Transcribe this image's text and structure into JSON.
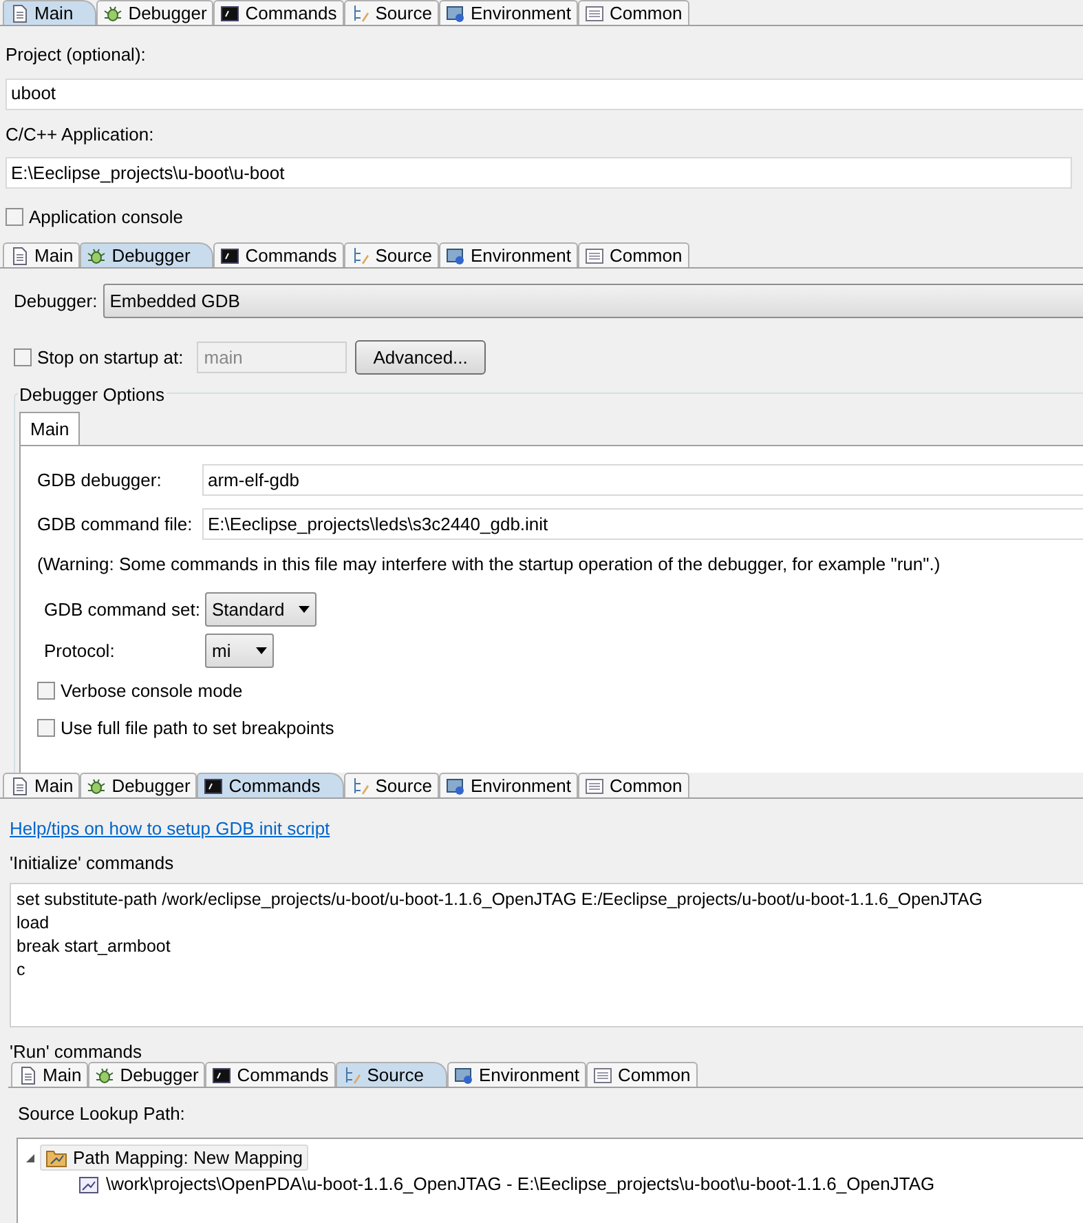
{
  "panels": [
    {
      "kind": "main",
      "tabs": [
        {
          "label": "Main",
          "kind": "page",
          "selected": true
        },
        {
          "label": "Debugger",
          "kind": "bug",
          "selected": false
        },
        {
          "label": "Commands",
          "kind": "terminal",
          "selected": false
        },
        {
          "label": "Source",
          "kind": "tree",
          "selected": false
        },
        {
          "label": "Environment",
          "kind": "env",
          "selected": false
        },
        {
          "label": "Common",
          "kind": "list",
          "selected": false
        }
      ],
      "project_label": "Project (optional):",
      "project_value": "uboot",
      "app_label": "C/C++ Application:",
      "app_value": "E:\\Eeclipse_projects\\u-boot\\u-boot",
      "console": {
        "label": "Application console",
        "checked": false
      }
    },
    {
      "kind": "debugger",
      "tabs": [
        {
          "label": "Main",
          "kind": "page",
          "selected": false
        },
        {
          "label": "Debugger",
          "kind": "bug",
          "selected": true
        },
        {
          "label": "Commands",
          "kind": "terminal",
          "selected": false
        },
        {
          "label": "Source",
          "kind": "tree",
          "selected": false
        },
        {
          "label": "Environment",
          "kind": "env",
          "selected": false
        },
        {
          "label": "Common",
          "kind": "list",
          "selected": false
        }
      ],
      "debugger_label": "Debugger:",
      "debugger_value": "Embedded GDB",
      "stop": {
        "label": "Stop on startup at:",
        "checked": false,
        "placeholder": "main"
      },
      "advanced_button": "Advanced...",
      "options_title": "Debugger Options",
      "options_tab": "Main",
      "gdb_label": "GDB debugger:",
      "gdb_value": "arm-elf-gdb",
      "cmdfile_label": "GDB command file:",
      "cmdfile_value": "E:\\Eeclipse_projects\\leds\\s3c2440_gdb.init",
      "warning": "(Warning: Some commands in this file may interfere with the startup operation of the debugger, for example \"run\".)",
      "cmdset_label": "GDB command set:",
      "cmdset_value": "Standard",
      "protocol_label": "Protocol:",
      "protocol_value": "mi",
      "options": [
        {
          "label": "Verbose console mode",
          "checked": false
        },
        {
          "label": "Use full file path to set breakpoints",
          "checked": false
        }
      ]
    },
    {
      "kind": "commands",
      "tabs": [
        {
          "label": "Main",
          "kind": "page",
          "selected": false
        },
        {
          "label": "Debugger",
          "kind": "bug",
          "selected": false
        },
        {
          "label": "Commands",
          "kind": "terminal",
          "selected": true
        },
        {
          "label": "Source",
          "kind": "tree",
          "selected": false
        },
        {
          "label": "Environment",
          "kind": "env",
          "selected": false
        },
        {
          "label": "Common",
          "kind": "list",
          "selected": false
        }
      ],
      "help_link": "Help/tips on how to setup GDB init script",
      "init_label": "'Initialize' commands",
      "init_lines": [
        "set substitute-path /work/eclipse_projects/u-boot/u-boot-1.1.6_OpenJTAG E:/Eeclipse_projects/u-boot/u-boot-1.1.6_OpenJTAG",
        "load",
        "break start_armboot",
        "c"
      ],
      "run_label": "'Run' commands"
    },
    {
      "kind": "source",
      "tabs": [
        {
          "label": "Main",
          "kind": "page",
          "selected": false
        },
        {
          "label": "Debugger",
          "kind": "bug",
          "selected": false
        },
        {
          "label": "Commands",
          "kind": "terminal",
          "selected": false
        },
        {
          "label": "Source",
          "kind": "tree",
          "selected": true
        },
        {
          "label": "Environment",
          "kind": "env",
          "selected": false
        },
        {
          "label": "Common",
          "kind": "list",
          "selected": false
        }
      ],
      "lookup_label": "Source Lookup Path:",
      "tree": [
        {
          "label": "Path Mapping: New Mapping",
          "expanded": true,
          "children": [
            {
              "label": "\\work\\projects\\OpenPDA\\u-boot-1.1.6_OpenJTAG - E:\\Eeclipse_projects\\u-boot\\u-boot-1.1.6_OpenJTAG"
            }
          ]
        }
      ]
    }
  ]
}
